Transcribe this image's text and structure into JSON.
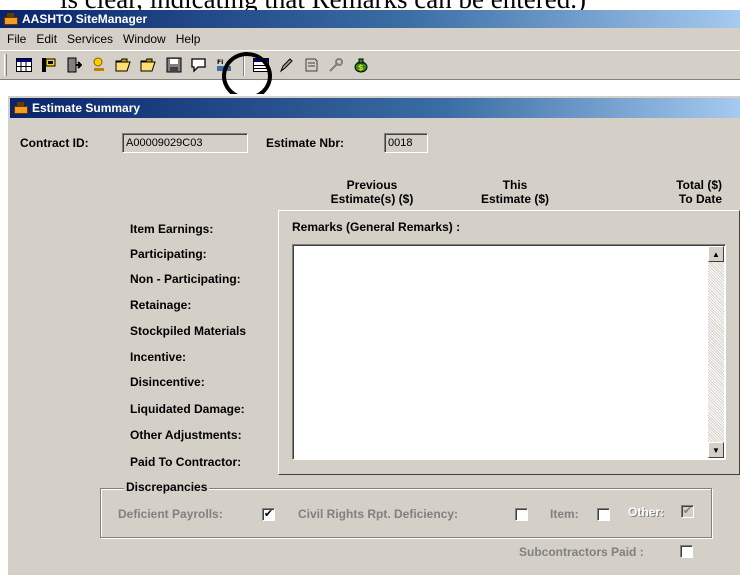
{
  "doc_caption": "is clear, indicating that Remarks can be entered.)",
  "app": {
    "title": "AASHTO SiteManager"
  },
  "menu": [
    "File",
    "Edit",
    "Services",
    "Window",
    "Help"
  ],
  "toolbar": {
    "icons": [
      "grid-icon",
      "flag-icon",
      "exit-icon",
      "wizard-icon",
      "open-folder-icon",
      "folder-icon",
      "save-icon",
      "remarks-icon",
      "filter-icon",
      "table-icon",
      "pen-icon",
      "report-icon",
      "tools-icon",
      "money-bag-icon"
    ]
  },
  "window": {
    "title": "Estimate Summary"
  },
  "contract": {
    "label": "Contract ID:",
    "value": "A00009029C03"
  },
  "estimate": {
    "label": "Estimate Nbr:",
    "value": "0018"
  },
  "columns": {
    "previous": "Previous\nEstimate(s) ($)",
    "this": "This\nEstimate ($)",
    "total": "Total ($)\nTo Date"
  },
  "rows": [
    "Item Earnings:",
    "Participating:",
    "Non - Participating:",
    "Retainage:",
    "Stockpiled Materials",
    "Incentive:",
    "Disincentive:",
    "Liquidated Damage:",
    "Other Adjustments:",
    "Paid To Contractor:"
  ],
  "remarks": {
    "label": "Remarks (General Remarks) :",
    "text": ""
  },
  "discrepancies": {
    "title": "Discrepancies",
    "deficient_payrolls": "Deficient Payrolls:",
    "civil_rights": "Civil Rights Rpt. Deficiency:",
    "item": "Item:",
    "other": "Other:",
    "subcontractors": "Subcontractors Paid :"
  },
  "checks": {
    "deficient_payrolls": true,
    "civil_rights": false,
    "item": false,
    "other": true,
    "subcontractors": false
  }
}
